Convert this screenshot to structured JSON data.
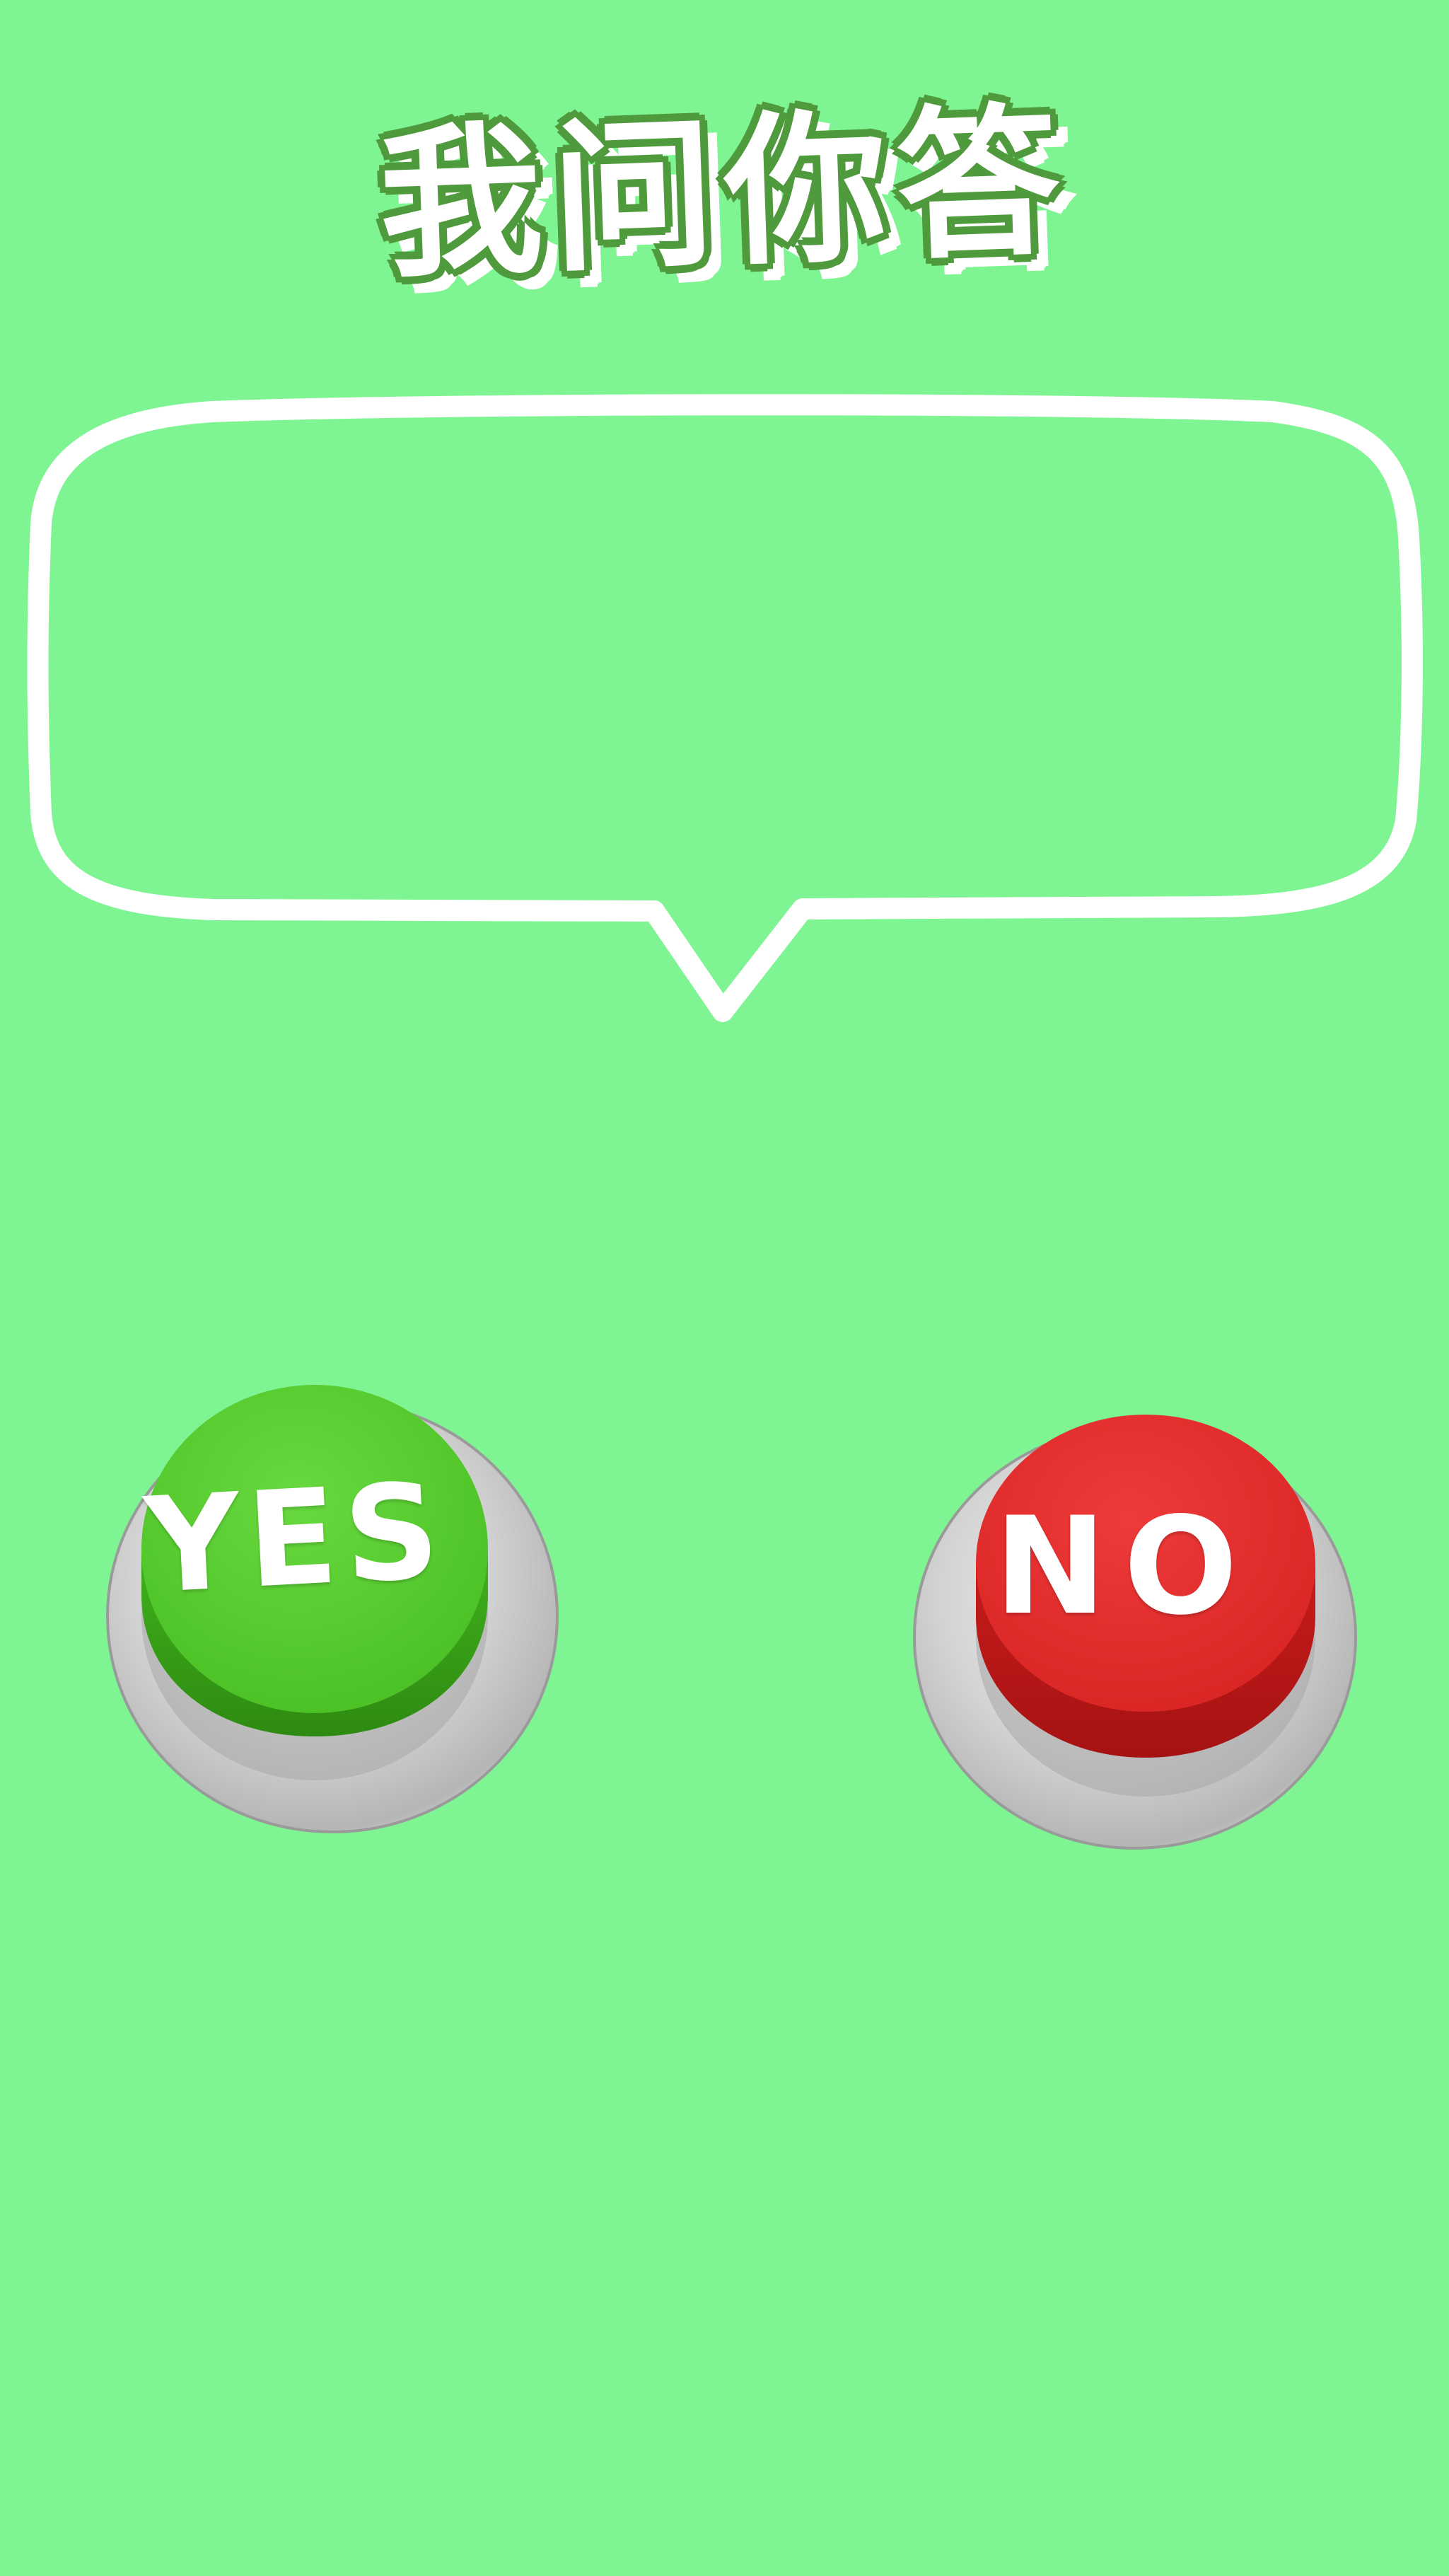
{
  "title": "我问你答",
  "bubble": {
    "text": ""
  },
  "buttons": {
    "yes_label": "YES",
    "no_label": "NO"
  },
  "colors": {
    "background": "#7EF592",
    "title_outline": "#4f9a3c",
    "yes_button": "#52cc2c",
    "no_button": "#e02828",
    "bubble_stroke": "#ffffff"
  }
}
